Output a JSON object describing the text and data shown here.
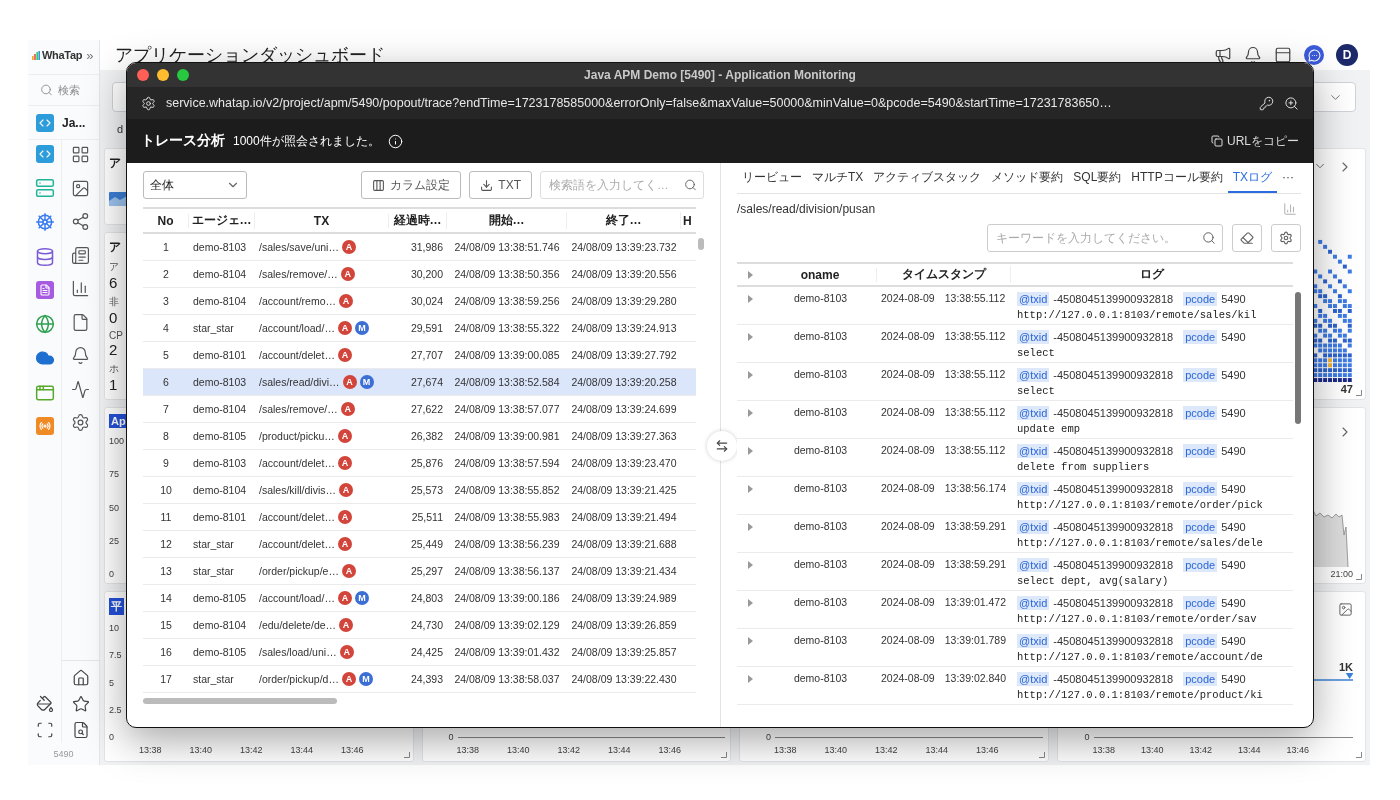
{
  "sidebar": {
    "logo": "WhaTap",
    "collapse": "»",
    "search_placeholder": "検索",
    "project": "Ja...",
    "project_code": "5490"
  },
  "header": {
    "title": "アプリケーションダッシュボード",
    "avatar": "D"
  },
  "filter": {
    "fragment": "d"
  },
  "cards": [
    {
      "kind": "title",
      "title": "ア"
    },
    {
      "kind": "stats",
      "title": "ア",
      "stats": [
        {
          "label": "ア",
          "value": "6"
        },
        {
          "label": "非",
          "value": "0"
        },
        {
          "label": "CP",
          "value": "2"
        },
        {
          "label": "ホ",
          "value": "1"
        }
      ]
    },
    {
      "kind": "yaxis",
      "badge": "Ap",
      "yticks": [
        "100",
        "75",
        "50",
        "25",
        "0"
      ]
    },
    {
      "kind": "yaxis",
      "badge": "平",
      "yticks": [
        "10",
        "7.5",
        "5",
        "2.5",
        "0"
      ],
      "xticks": [
        "13:38",
        "13:40",
        "13:42",
        "13:44",
        "13:46"
      ]
    },
    {
      "kind": "axis",
      "zero": "0",
      "xticks": [
        "13:38",
        "13:40",
        "13:42",
        "13:44",
        "13:46"
      ]
    },
    {
      "kind": "axis",
      "zero": "0",
      "xticks": [
        "13:38",
        "13:40",
        "13:42",
        "13:44",
        "13:46"
      ]
    },
    {
      "kind": "heatmap",
      "value": "47"
    },
    {
      "kind": "line",
      "xtick": "21:00"
    },
    {
      "kind": "level",
      "value": "1K",
      "zero": "0",
      "xticks": [
        "13:38",
        "13:40",
        "13:42",
        "13:44",
        "13:46"
      ]
    }
  ],
  "popup": {
    "window_title": "Java APM Demo [5490] - Application Monitoring",
    "url": "service.whatap.io/v2/project/apm/5490/popout/trace?endTime=1723178585000&errorOnly=false&maxValue=50000&minValue=0&pcode=5490&startTime=17231783650…",
    "page_title": "トレース分析",
    "result_count": "1000件が照会されました。",
    "copy_url": "URLをコピー",
    "trace_list": {
      "filter": "全体",
      "column_settings": "カラム設定",
      "export": "TXT",
      "search_placeholder": "検索語を入力してく…",
      "columns": [
        "No",
        "エージェ…",
        "TX",
        "経過時…",
        "開始…",
        "終了…",
        "H"
      ],
      "rows": [
        {
          "no": "1",
          "agent": "demo-8103",
          "tx": "/sales/save/uni…",
          "badges": [
            {
              "text": "A",
              "color": "#d2453b"
            }
          ],
          "elapsed": "31,986",
          "start": "24/08/09 13:38:51.746",
          "end": "24/08/09 13:39:23.732",
          "selected": false
        },
        {
          "no": "2",
          "agent": "demo-8104",
          "tx": "/sales/remove/…",
          "badges": [
            {
              "text": "A",
              "color": "#d2453b"
            }
          ],
          "elapsed": "30,200",
          "start": "24/08/09 13:38:50.356",
          "end": "24/08/09 13:39:20.556",
          "selected": false
        },
        {
          "no": "3",
          "agent": "demo-8104",
          "tx": "/account/remo…",
          "badges": [
            {
              "text": "A",
              "color": "#d2453b"
            }
          ],
          "elapsed": "30,024",
          "start": "24/08/09 13:38:59.256",
          "end": "24/08/09 13:39:29.280",
          "selected": false
        },
        {
          "no": "4",
          "agent": "star_star",
          "tx": "/account/load/…",
          "badges": [
            {
              "text": "A",
              "color": "#d2453b"
            },
            {
              "text": "M",
              "color": "#3b6fd6"
            }
          ],
          "elapsed": "29,591",
          "start": "24/08/09 13:38:55.322",
          "end": "24/08/09 13:39:24.913",
          "selected": false
        },
        {
          "no": "5",
          "agent": "demo-8101",
          "tx": "/account/delet…",
          "badges": [
            {
              "text": "A",
              "color": "#d2453b"
            }
          ],
          "elapsed": "27,707",
          "start": "24/08/09 13:39:00.085",
          "end": "24/08/09 13:39:27.792",
          "selected": false
        },
        {
          "no": "6",
          "agent": "demo-8103",
          "tx": "/sales/read/divi…",
          "badges": [
            {
              "text": "A",
              "color": "#d2453b"
            },
            {
              "text": "M",
              "color": "#3b6fd6"
            }
          ],
          "elapsed": "27,674",
          "start": "24/08/09 13:38:52.584",
          "end": "24/08/09 13:39:20.258",
          "selected": true
        },
        {
          "no": "7",
          "agent": "demo-8104",
          "tx": "/sales/remove/…",
          "badges": [
            {
              "text": "A",
              "color": "#d2453b"
            }
          ],
          "elapsed": "27,622",
          "start": "24/08/09 13:38:57.077",
          "end": "24/08/09 13:39:24.699",
          "selected": false
        },
        {
          "no": "8",
          "agent": "demo-8105",
          "tx": "/product/picku…",
          "badges": [
            {
              "text": "A",
              "color": "#d2453b"
            }
          ],
          "elapsed": "26,382",
          "start": "24/08/09 13:39:00.981",
          "end": "24/08/09 13:39:27.363",
          "selected": false
        },
        {
          "no": "9",
          "agent": "demo-8103",
          "tx": "/account/delet…",
          "badges": [
            {
              "text": "A",
              "color": "#d2453b"
            }
          ],
          "elapsed": "25,876",
          "start": "24/08/09 13:38:57.594",
          "end": "24/08/09 13:39:23.470",
          "selected": false
        },
        {
          "no": "10",
          "agent": "demo-8104",
          "tx": "/sales/kill/divis…",
          "badges": [
            {
              "text": "A",
              "color": "#d2453b"
            }
          ],
          "elapsed": "25,573",
          "start": "24/08/09 13:38:55.852",
          "end": "24/08/09 13:39:21.425",
          "selected": false
        },
        {
          "no": "11",
          "agent": "demo-8101",
          "tx": "/account/delet…",
          "badges": [
            {
              "text": "A",
              "color": "#d2453b"
            }
          ],
          "elapsed": "25,511",
          "start": "24/08/09 13:38:55.983",
          "end": "24/08/09 13:39:21.494",
          "selected": false
        },
        {
          "no": "12",
          "agent": "star_star",
          "tx": "/account/delet…",
          "badges": [
            {
              "text": "A",
              "color": "#d2453b"
            }
          ],
          "elapsed": "25,449",
          "start": "24/08/09 13:38:56.239",
          "end": "24/08/09 13:39:21.688",
          "selected": false
        },
        {
          "no": "13",
          "agent": "star_star",
          "tx": "/order/pickup/e…",
          "badges": [
            {
              "text": "A",
              "color": "#d2453b"
            }
          ],
          "elapsed": "25,297",
          "start": "24/08/09 13:38:56.137",
          "end": "24/08/09 13:39:21.434",
          "selected": false
        },
        {
          "no": "14",
          "agent": "demo-8105",
          "tx": "/account/load/…",
          "badges": [
            {
              "text": "A",
              "color": "#d2453b"
            },
            {
              "text": "M",
              "color": "#3b6fd6"
            }
          ],
          "elapsed": "24,803",
          "start": "24/08/09 13:39:00.186",
          "end": "24/08/09 13:39:24.989",
          "selected": false
        },
        {
          "no": "15",
          "agent": "demo-8104",
          "tx": "/edu/delete/de…",
          "badges": [
            {
              "text": "A",
              "color": "#d2453b"
            }
          ],
          "elapsed": "24,730",
          "start": "24/08/09 13:39:02.129",
          "end": "24/08/09 13:39:26.859",
          "selected": false
        },
        {
          "no": "16",
          "agent": "demo-8105",
          "tx": "/sales/load/uni…",
          "badges": [
            {
              "text": "A",
              "color": "#d2453b"
            }
          ],
          "elapsed": "24,425",
          "start": "24/08/09 13:39:01.432",
          "end": "24/08/09 13:39:25.857",
          "selected": false
        },
        {
          "no": "17",
          "agent": "star_star",
          "tx": "/order/pickup/d…",
          "badges": [
            {
              "text": "A",
              "color": "#d2453b"
            },
            {
              "text": "M",
              "color": "#3b6fd6"
            }
          ],
          "elapsed": "24,393",
          "start": "24/08/09 13:38:58.037",
          "end": "24/08/09 13:39:22.430",
          "selected": false
        }
      ]
    },
    "detail": {
      "tabs": [
        {
          "label": "リービュー",
          "selected": false
        },
        {
          "label": "マルチTX",
          "selected": false
        },
        {
          "label": "アクティブスタック",
          "selected": false
        },
        {
          "label": "メソッド要約",
          "selected": false
        },
        {
          "label": "SQL要約",
          "selected": false
        },
        {
          "label": "HTTPコール要約",
          "selected": false
        },
        {
          "label": "TXログ",
          "selected": true
        }
      ],
      "more": "···",
      "path": "/sales/read/division/pusan",
      "search_placeholder": "キーワードを入力してください。",
      "columns": [
        "oname",
        "タイムスタンプ",
        "ログ"
      ],
      "rows": [
        {
          "oname": "demo-8103",
          "date": "2024-08-09",
          "time": "13:38:55.112",
          "tags": [
            {
              "key": "@txid",
              "value": "-4508045139900932818"
            },
            {
              "key": "pcode",
              "value": "5490"
            }
          ],
          "message": "http://127.0.0.1:8103/remote/sales/kil"
        },
        {
          "oname": "demo-8103",
          "date": "2024-08-09",
          "time": "13:38:55.112",
          "tags": [
            {
              "key": "@txid",
              "value": "-4508045139900932818"
            },
            {
              "key": "pcode",
              "value": "5490"
            }
          ],
          "message": "select"
        },
        {
          "oname": "demo-8103",
          "date": "2024-08-09",
          "time": "13:38:55.112",
          "tags": [
            {
              "key": "@txid",
              "value": "-4508045139900932818"
            },
            {
              "key": "pcode",
              "value": "5490"
            }
          ],
          "message": "select"
        },
        {
          "oname": "demo-8103",
          "date": "2024-08-09",
          "time": "13:38:55.112",
          "tags": [
            {
              "key": "@txid",
              "value": "-4508045139900932818"
            },
            {
              "key": "pcode",
              "value": "5490"
            }
          ],
          "message": "update emp"
        },
        {
          "oname": "demo-8103",
          "date": "2024-08-09",
          "time": "13:38:55.112",
          "tags": [
            {
              "key": "@txid",
              "value": "-4508045139900932818"
            },
            {
              "key": "pcode",
              "value": "5490"
            }
          ],
          "message": "delete from suppliers"
        },
        {
          "oname": "demo-8103",
          "date": "2024-08-09",
          "time": "13:38:56.174",
          "tags": [
            {
              "key": "@txid",
              "value": "-4508045139900932818"
            },
            {
              "key": "pcode",
              "value": "5490"
            }
          ],
          "message": "http://127.0.0.1:8103/remote/order/pick"
        },
        {
          "oname": "demo-8103",
          "date": "2024-08-09",
          "time": "13:38:59.291",
          "tags": [
            {
              "key": "@txid",
              "value": "-4508045139900932818"
            },
            {
              "key": "pcode",
              "value": "5490"
            }
          ],
          "message": "http://127.0.0.1:8103/remote/sales/dele"
        },
        {
          "oname": "demo-8103",
          "date": "2024-08-09",
          "time": "13:38:59.291",
          "tags": [
            {
              "key": "@txid",
              "value": "-4508045139900932818"
            },
            {
              "key": "pcode",
              "value": "5490"
            }
          ],
          "message": "select dept, avg(salary)"
        },
        {
          "oname": "demo-8103",
          "date": "2024-08-09",
          "time": "13:39:01.472",
          "tags": [
            {
              "key": "@txid",
              "value": "-4508045139900932818"
            },
            {
              "key": "pcode",
              "value": "5490"
            }
          ],
          "message": "http://127.0.0.1:8103/remote/order/sav"
        },
        {
          "oname": "demo-8103",
          "date": "2024-08-09",
          "time": "13:39:01.789",
          "tags": [
            {
              "key": "@txid",
              "value": "-4508045139900932818"
            },
            {
              "key": "pcode",
              "value": "5490"
            }
          ],
          "message": "http://127.0.0.1:8103/remote/account/de"
        },
        {
          "oname": "demo-8103",
          "date": "2024-08-09",
          "time": "13:39:02.840",
          "tags": [
            {
              "key": "@txid",
              "value": "-4508045139900932818"
            },
            {
              "key": "pcode",
              "value": "5490"
            }
          ],
          "message": "http://127.0.0.1:8103/remote/product/ki"
        }
      ]
    }
  }
}
